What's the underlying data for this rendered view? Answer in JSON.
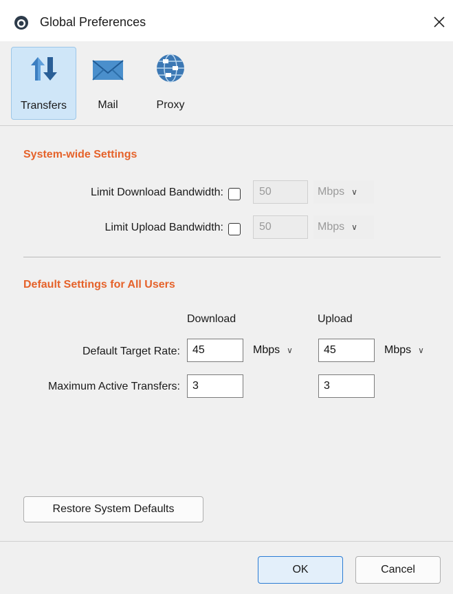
{
  "window": {
    "title": "Global Preferences"
  },
  "toolbar": {
    "items": [
      {
        "label": "Transfers",
        "icon": "transfers-icon",
        "selected": true
      },
      {
        "label": "Mail",
        "icon": "mail-icon",
        "selected": false
      },
      {
        "label": "Proxy",
        "icon": "proxy-icon",
        "selected": false
      }
    ]
  },
  "system": {
    "title": "System-wide Settings",
    "download": {
      "label": "Limit Download Bandwidth:",
      "checked": false,
      "value": "50",
      "unit": "Mbps"
    },
    "upload": {
      "label": "Limit Upload Bandwidth:",
      "checked": false,
      "value": "50",
      "unit": "Mbps"
    }
  },
  "defaults": {
    "title": "Default Settings for All Users",
    "col_download": "Download",
    "col_upload": "Upload",
    "target_rate": {
      "label": "Default Target Rate:",
      "download_value": "45",
      "download_unit": "Mbps",
      "upload_value": "45",
      "upload_unit": "Mbps"
    },
    "max_active": {
      "label": "Maximum Active Transfers:",
      "download_value": "3",
      "upload_value": "3"
    }
  },
  "buttons": {
    "restore": "Restore System Defaults",
    "ok": "OK",
    "cancel": "Cancel"
  },
  "colors": {
    "section_title": "#e5622a",
    "selected_tab_bg": "#cfe6f8",
    "primary_border": "#2a7bd4"
  }
}
